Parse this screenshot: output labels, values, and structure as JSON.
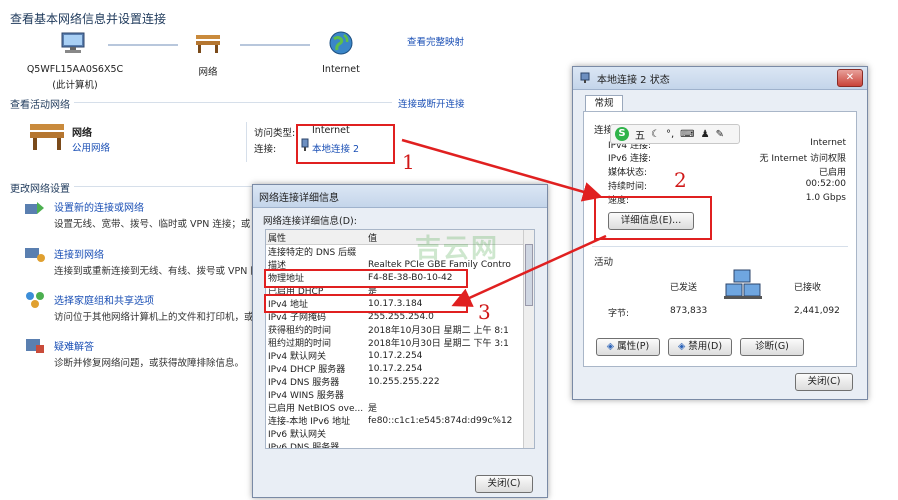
{
  "network_center": {
    "title": "查看基本网络信息并设置连接",
    "view_full_map": "查看完整映射",
    "computer_name": "Q5WFL15AA0S6X5C",
    "computer_sub": "(此计算机)",
    "network_node": "网络",
    "internet_node": "Internet",
    "active_networks_heading": "查看活动网络",
    "connect_disconnect": "连接或断开连接",
    "network_name": "网络",
    "network_type": "公用网络",
    "access_type_label": "访问类型:",
    "access_type_value": "Internet",
    "connection_label": "连接:",
    "connection_value": "本地连接 2",
    "change_settings_heading": "更改网络设置",
    "tasks": [
      {
        "title": "设置新的连接或网络",
        "desc": "设置无线、宽带、拨号、临时或 VPN 连接；或"
      },
      {
        "title": "连接到网络",
        "desc": "连接到或重新连接到无线、有线、拨号或 VPN 网"
      },
      {
        "title": "选择家庭组和共享选项",
        "desc": "访问位于其他网络计算机上的文件和打印机，或更"
      },
      {
        "title": "疑难解答",
        "desc": "诊断并修复网络问题，或获得故障排除信息。"
      }
    ]
  },
  "status_window": {
    "title": "本地连接 2 状态",
    "tab": "常规",
    "connection_group": "连接",
    "rows": [
      {
        "k": "IPv4 连接:",
        "v": "Internet"
      },
      {
        "k": "IPv6 连接:",
        "v": "无 Internet 访问权限"
      },
      {
        "k": "媒体状态:",
        "v": "已启用"
      },
      {
        "k": "持续时间:",
        "v": "00:52:00"
      },
      {
        "k": "速度:",
        "v": "1.0 Gbps"
      }
    ],
    "details_button": "详细信息(E)...",
    "activity_group": "活动",
    "sent_label": "已发送",
    "received_label": "已接收",
    "bytes_label": "字节:",
    "bytes_sent": "873,833",
    "bytes_received": "2,441,092",
    "properties_button": "属性(P)",
    "disable_button": "禁用(D)",
    "diagnose_button": "诊断(G)",
    "close_button": "关闭(C)",
    "ime_toolbar": "五"
  },
  "details_window": {
    "title": "网络连接详细信息",
    "subtitle": "网络连接详细信息(D):",
    "col_property": "属性",
    "col_value": "值",
    "rows": [
      {
        "k": "连接特定的 DNS 后缀",
        "v": ""
      },
      {
        "k": "描述",
        "v": "Realtek PCIe GBE Family Contro"
      },
      {
        "k": "物理地址",
        "v": "F4-8E-38-B0-10-42"
      },
      {
        "k": "已启用 DHCP",
        "v": "是"
      },
      {
        "k": "IPv4 地址",
        "v": "10.17.3.184"
      },
      {
        "k": "IPv4 子网掩码",
        "v": "255.255.254.0"
      },
      {
        "k": "获得租约的时间",
        "v": "2018年10月30日 星期二 上午 8:1"
      },
      {
        "k": "租约过期的时间",
        "v": "2018年10月30日 星期二 下午 3:1"
      },
      {
        "k": "IPv4 默认网关",
        "v": "10.17.2.254"
      },
      {
        "k": "IPv4 DHCP 服务器",
        "v": "10.17.2.254"
      },
      {
        "k": "IPv4 DNS 服务器",
        "v": "10.255.255.222"
      },
      {
        "k": "IPv4 WINS 服务器",
        "v": ""
      },
      {
        "k": "已启用 NetBIOS ove...",
        "v": "是"
      },
      {
        "k": "连接-本地 IPv6 地址",
        "v": "fe80::c1c1:e545:874d:d99c%12"
      },
      {
        "k": "IPv6 默认网关",
        "v": ""
      },
      {
        "k": "IPv6 DNS 服务器",
        "v": ""
      }
    ],
    "close_button": "关闭(C)"
  },
  "annotations": {
    "n1": "1",
    "n2": "2",
    "n3": "3",
    "watermark": "吉云网"
  },
  "colors": {
    "accent_link": "#1a4fb5",
    "annotation_red": "#e02020"
  }
}
